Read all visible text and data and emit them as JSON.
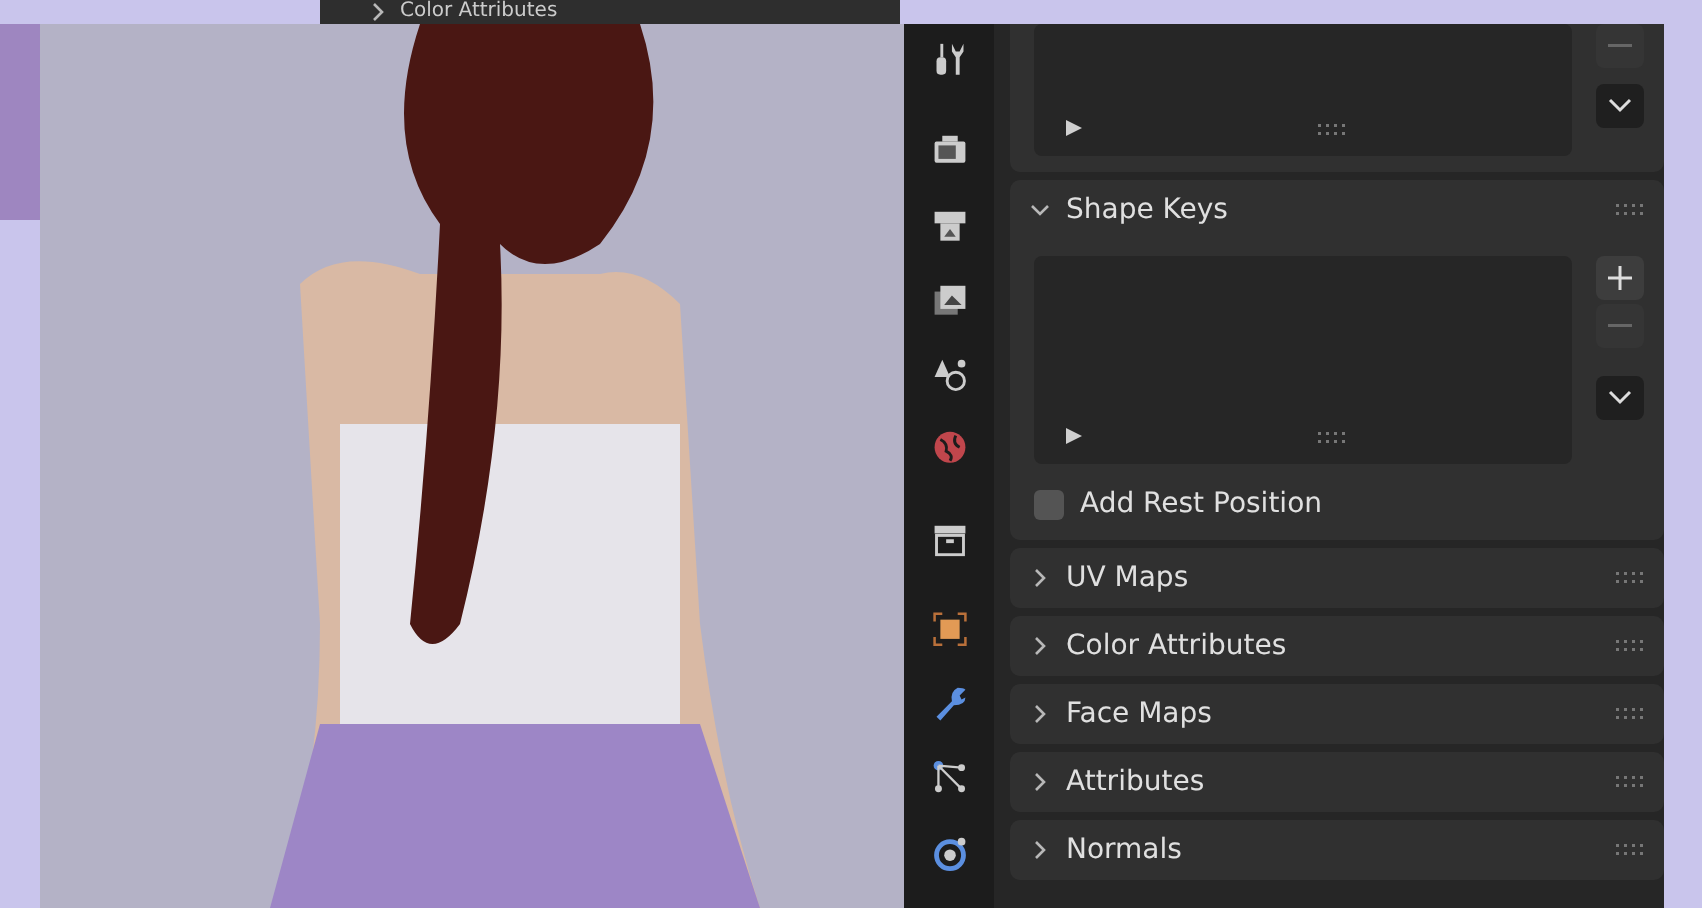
{
  "background_window": {
    "panel": {
      "title": "Color Attributes",
      "expanded": false
    }
  },
  "properties": {
    "shape_keys": {
      "title": "Shape Keys",
      "expanded": true,
      "add_rest_position": {
        "label": "Add Rest Position",
        "checked": false
      }
    },
    "panels": [
      {
        "title": "UV Maps",
        "expanded": false
      },
      {
        "title": "Color Attributes",
        "expanded": false
      },
      {
        "title": "Face Maps",
        "expanded": false
      },
      {
        "title": "Attributes",
        "expanded": false
      },
      {
        "title": "Normals",
        "expanded": false
      }
    ]
  }
}
